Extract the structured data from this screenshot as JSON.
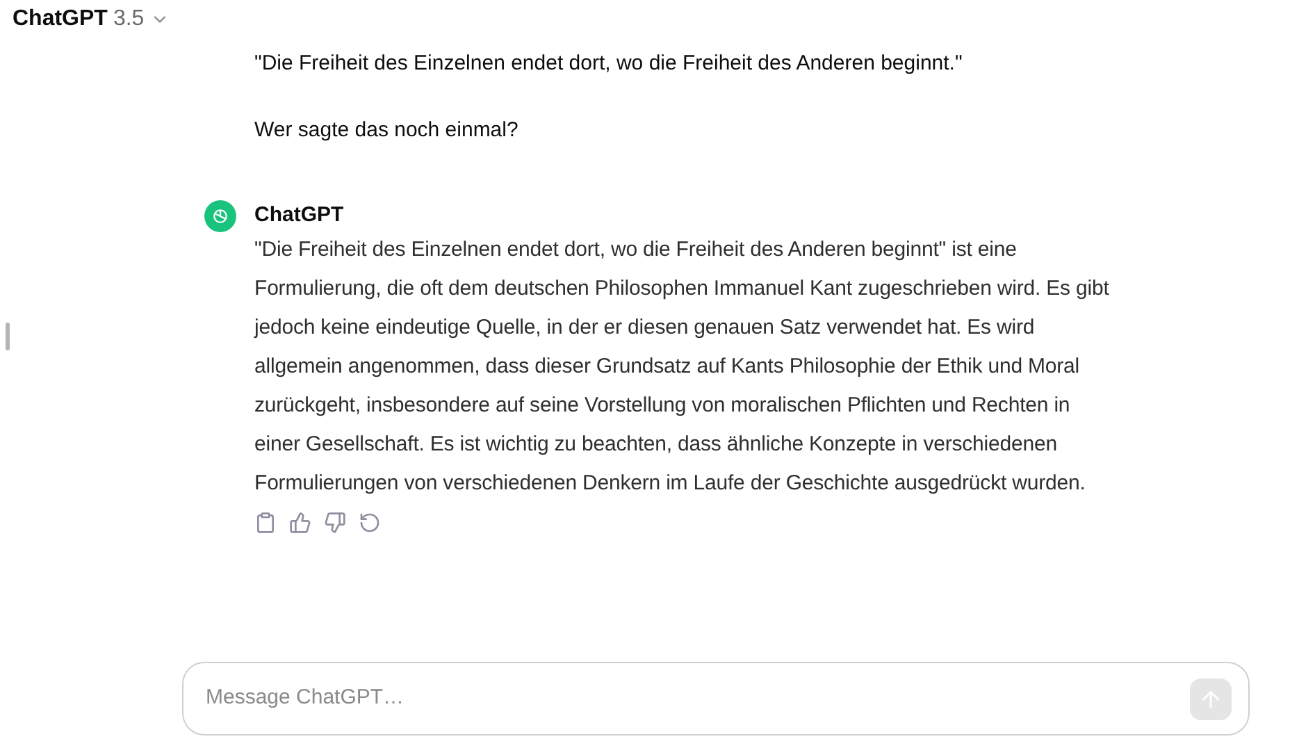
{
  "header": {
    "title": "ChatGPT",
    "version": "3.5"
  },
  "user_message": {
    "lines": [
      "\"Die Freiheit des Einzelnen endet dort, wo die Freiheit des Anderen beginnt.\"",
      "Wer sagte das noch einmal?"
    ]
  },
  "assistant_message": {
    "author": "ChatGPT",
    "text": "\"Die Freiheit des Einzelnen endet dort, wo die Freiheit des Anderen beginnt\" ist eine Formulierung, die oft dem deutschen Philosophen Immanuel Kant zugeschrieben wird. Es gibt jedoch keine eindeutige Quelle, in der er diesen genauen Satz verwendet hat. Es wird allgemein angenommen, dass dieser Grundsatz auf Kants Philosophie der Ethik und Moral zurückgeht, insbesondere auf seine Vorstellung von moralischen Pflichten und Rechten in einer Gesellschaft. Es ist wichtig zu beachten, dass ähnliche Konzepte in verschiedenen Formulierungen von verschiedenen Denkern im Laufe der Geschichte ausgedrückt wurden."
  },
  "composer": {
    "placeholder": "Message ChatGPT…",
    "send_disabled": true
  }
}
